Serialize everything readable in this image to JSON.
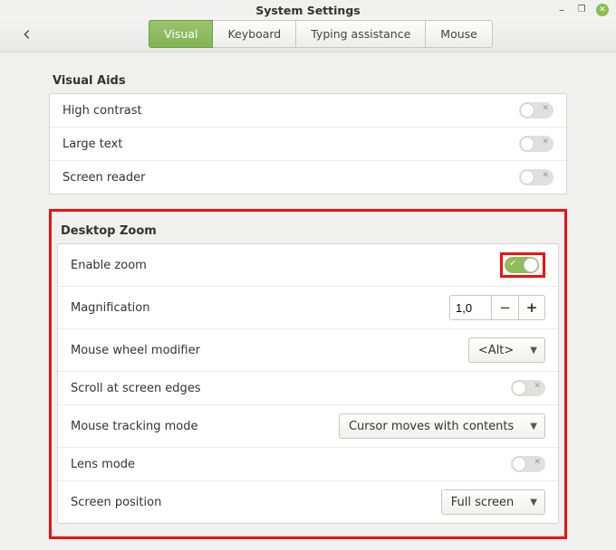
{
  "window": {
    "title": "System Settings"
  },
  "tabs": {
    "visual": "Visual",
    "keyboard": "Keyboard",
    "typing": "Typing assistance",
    "mouse": "Mouse",
    "active": "visual"
  },
  "sections": {
    "visual_aids": {
      "title": "Visual Aids",
      "high_contrast": {
        "label": "High contrast",
        "on": false
      },
      "large_text": {
        "label": "Large text",
        "on": false
      },
      "screen_reader": {
        "label": "Screen reader",
        "on": false
      }
    },
    "desktop_zoom": {
      "title": "Desktop Zoom",
      "enable_zoom": {
        "label": "Enable zoom",
        "on": true
      },
      "magnification": {
        "label": "Magnification",
        "value": "1,0"
      },
      "mouse_wheel_modifier": {
        "label": "Mouse wheel modifier",
        "value": "<Alt>"
      },
      "scroll_at_edges": {
        "label": "Scroll at screen edges",
        "on": false
      },
      "mouse_tracking_mode": {
        "label": "Mouse tracking mode",
        "value": "Cursor moves with contents"
      },
      "lens_mode": {
        "label": "Lens mode",
        "on": false
      },
      "screen_position": {
        "label": "Screen position",
        "value": "Full screen"
      }
    }
  }
}
